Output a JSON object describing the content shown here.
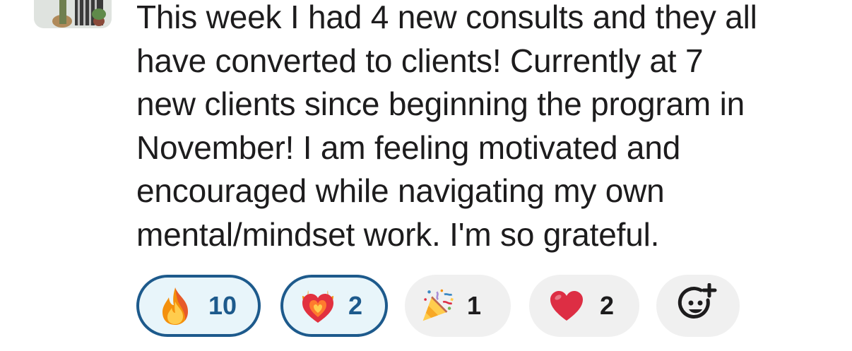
{
  "message": {
    "text": "This week I had 4 new consults and they all\nhave converted to clients! Currently at 7\nnew clients since beginning the program in\nNovember! I am feeling motivated and\nencouraged while navigating my own\nmental/mindset work. I'm so grateful."
  },
  "reactions": [
    {
      "icon": "fire-emoji",
      "count": "10",
      "active": true
    },
    {
      "icon": "heart-on-fire-emoji",
      "count": "2",
      "active": true
    },
    {
      "icon": "party-popper-emoji",
      "count": "1",
      "active": false
    },
    {
      "icon": "red-heart-emoji",
      "count": "2",
      "active": false
    }
  ],
  "add_reaction": {
    "icon": "add-emoji-icon"
  },
  "colors": {
    "active_border": "#1d5a8c",
    "active_background": "#e8f5fa",
    "pill_background": "#f0f0f0",
    "text": "#1d1c1d"
  }
}
